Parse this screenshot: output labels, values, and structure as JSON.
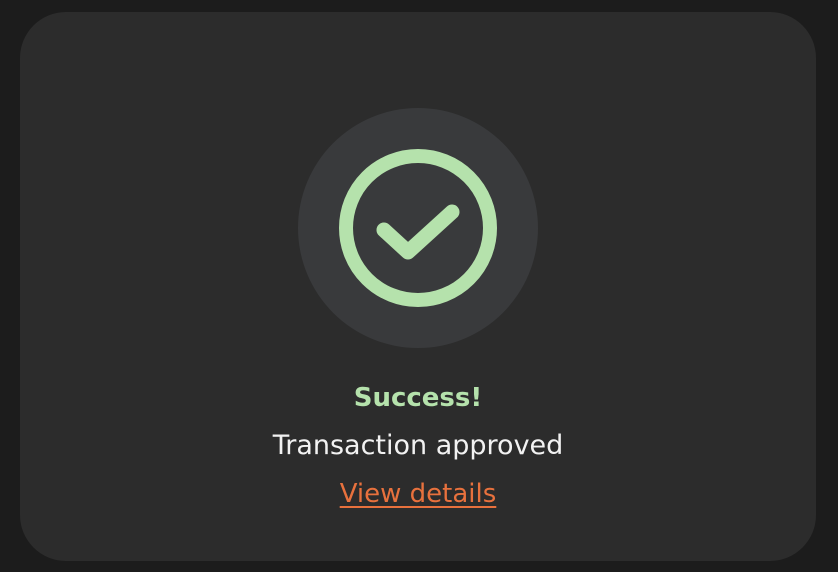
{
  "dialog": {
    "icon": "check-circle-icon",
    "title": "Success!",
    "message": "Transaction approved",
    "link_label": "View details"
  },
  "colors": {
    "page_background": "#1c1c1c",
    "card_background": "#2c2c2c",
    "icon_disc_background": "#393a3c",
    "success_green": "#b5e2ac",
    "message_text": "#f2f2f2",
    "link_orange": "#e8713d"
  }
}
